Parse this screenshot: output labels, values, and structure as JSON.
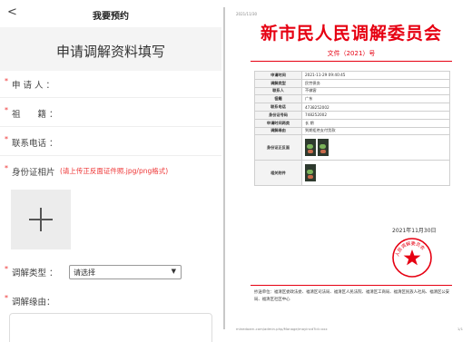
{
  "mobile": {
    "back_glyph": "<",
    "nav_title": "我要预约",
    "form_title": "申请调解资料填写",
    "fields": {
      "applicant": {
        "required": "*",
        "label": "申 请 人 ："
      },
      "origin": {
        "required": "*",
        "label": "祖　　籍 ："
      },
      "phone": {
        "required": "*",
        "label": "联系电话 ："
      },
      "id_photo": {
        "required": "*",
        "label": "身份证相片",
        "note": "(请上传正反面证件照.jpg/png格式)"
      },
      "mediation_type": {
        "required": "*",
        "label": "调解类型 ：",
        "selected": "请选择",
        "arrow": "▼"
      },
      "reason": {
        "required": "*",
        "label": "调解缘由："
      }
    },
    "icons": {
      "back": "chevron-left-icon",
      "upload": "plus-icon",
      "dropdown": "caret-down-icon"
    }
  },
  "document": {
    "header_small": "2021/11/30",
    "title": "新市民人民调解委员会",
    "subtitle": "文件（2021）号",
    "rows": [
      {
        "key": "申请时间",
        "value": "2021-11-29 09:40:45"
      },
      {
        "key": "调解类型",
        "value": "民劳债务"
      },
      {
        "key": "联系人",
        "value": "不做客"
      },
      {
        "key": "祖籍",
        "value": "广东"
      },
      {
        "key": "联系电话",
        "value": "4738252002"
      },
      {
        "key": "身份证号码",
        "value": "748252002"
      },
      {
        "key": "申请时间两类",
        "value": "长 期"
      },
      {
        "key": "调解缘由",
        "value": "到期拒绝支付货款"
      }
    ],
    "image_rows": [
      {
        "key": "身份证正反面"
      },
      {
        "key": "相关附件"
      }
    ],
    "date": "2021年11月30日",
    "seal_text": "人民调解委员会",
    "cc": "抄送单位：福清区委政法委、福清区司法局、福清区人民法院、福清区工商局、福清区民族人社局、福清区公安局、福清区社区中心",
    "footer_left": "minedoarn.com/admin.php/Manage/mayincd?id=xxx",
    "footer_right": "1/1",
    "colors": {
      "red": "#e60012"
    }
  }
}
